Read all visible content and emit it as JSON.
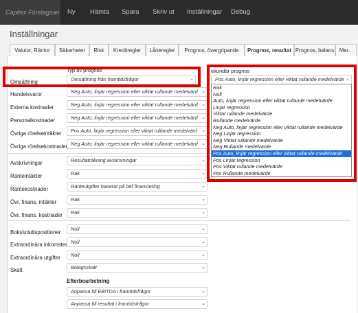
{
  "topbar": {
    "brand": "Capitex Företagsan",
    "menu": [
      "Ny",
      "Hämta",
      "Spara",
      "Skriv ut",
      "Inställningar",
      "Debug"
    ]
  },
  "page": {
    "title": "Inställningar"
  },
  "tabs": [
    "Valutor, Räntor",
    "Säkerheter",
    "Risk",
    "Kreditregler",
    "Låneregler",
    "Prognos, övergripande",
    "Prognos, resultat",
    "Prognos, balans",
    "Mer..."
  ],
  "active_tab": "Prognos, resultat",
  "headers": {
    "type": "Typ av prognos",
    "secondary": "ekundär prognos",
    "post": "Efterbearbetning"
  },
  "rows": [
    {
      "label": "Omsättning",
      "value": "Omsättning från framtidsfrågor"
    },
    {
      "label": "Handelsvaror",
      "value": "Neg Auto, linjär regression eller viktat rullande medelvärd"
    },
    {
      "label": "Externa kostnader",
      "value": "Neg Auto, linjär regression eller viktat rullande medelvärd"
    },
    {
      "label": "Personalkostnader",
      "value": "Neg Auto, linjär regression eller viktat rullande medelvärd"
    },
    {
      "label": "Övriga rörelseintäkter",
      "value": "Pos Auto, linjär regression eller viktat rullande medelvärd"
    },
    {
      "label": "Övriga rörelsekostnader",
      "value": "Neg Auto, linjär regression eller viktat rullande medelvärd"
    },
    {
      "label": "Avskrivningar",
      "value": "Resultaträkning avskrivningar"
    },
    {
      "label": "Ränteintäkter",
      "value": "Rak"
    },
    {
      "label": "Räntekostnader",
      "value": "Ränteutgifter baserat på bef finansiering"
    },
    {
      "label": "Övr. finans. intäkter",
      "value": "Rak"
    },
    {
      "label": "Övr. finans. kostnader",
      "value": "Rak"
    },
    {
      "label": "Bokslutsdispositioner",
      "value": "Noll"
    },
    {
      "label": "Extraordinära inkomster",
      "value": "Noll"
    },
    {
      "label": "Extraordinära utgifter",
      "value": "Noll"
    },
    {
      "label": "Skatt",
      "value": "Bolagsskatt"
    }
  ],
  "secondary_select": {
    "value": "Pos Auto, linjär regression eller viktat rullande medelvärde"
  },
  "post_processing": [
    "Anpassa till EBITDA i framtidsfrågor",
    "Anpassa till resultat i framtidsfrågor"
  ],
  "dropdown_options": [
    "Rak",
    "Noll",
    "Auto, linjär regression eller viktat rullande medelvärde",
    "Linjär regression",
    "Viktat rullande medelvärde",
    "Rullande medelvärde",
    "Neg Auto, linjär regression eller viktat rullande medelvärde",
    "Neg Linjär regression",
    "Neg Viktat rullande medelvärde",
    "Neg Rullande medelvärde",
    "Pos Auto, linjär regression eller viktat rullande medelvärde",
    "Pos Linjär regression",
    "Pos Viktat rullande medelvärde",
    "Pos Rullande medelvärde"
  ],
  "dropdown_selected": "Pos Auto, linjär regression eller viktat rullande medelvärde",
  "colors": {
    "topbar": "#2b2b2b",
    "highlight": "#e00000",
    "selection": "#1e6fd9"
  }
}
